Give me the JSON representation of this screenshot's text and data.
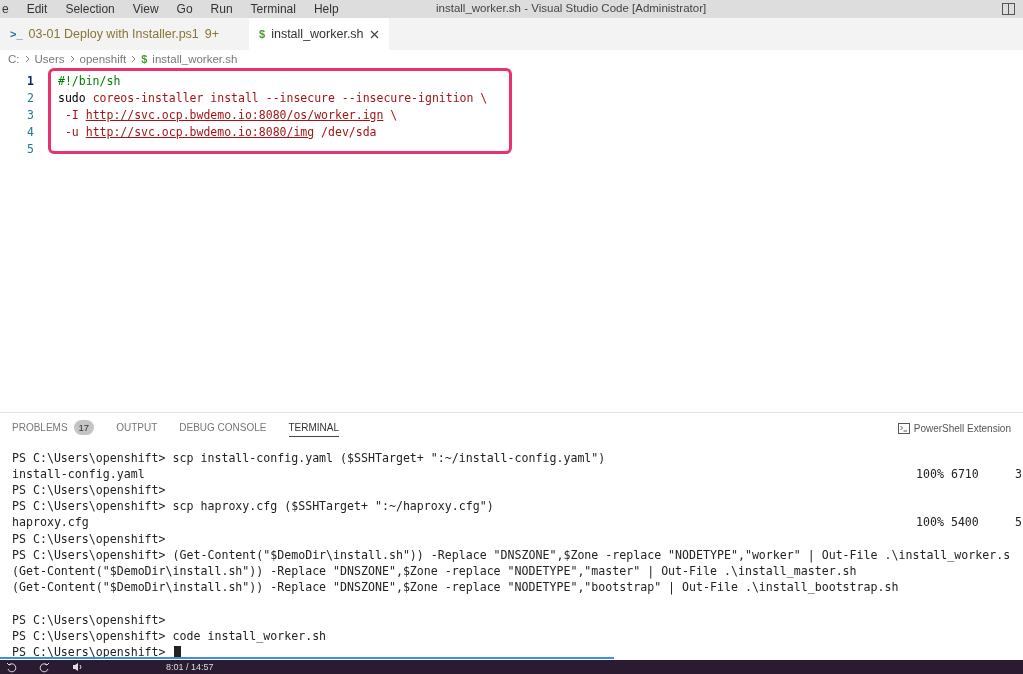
{
  "menu": [
    "e",
    "Edit",
    "Selection",
    "View",
    "Go",
    "Run",
    "Terminal",
    "Help"
  ],
  "window": {
    "title": "install_worker.sh - Visual Studio Code [Administrator]"
  },
  "tabs": [
    {
      "icon": ">_",
      "label": "03-01 Deploy with Installer.ps1",
      "badge": "9+",
      "selected": false
    },
    {
      "icon": "$",
      "label": "install_worker.sh",
      "selected": true
    }
  ],
  "breadcrumb": [
    {
      "label": "C:"
    },
    {
      "label": "Users"
    },
    {
      "label": "openshift"
    },
    {
      "icon": "$",
      "label": "install_worker.sh"
    }
  ],
  "editor": {
    "lines": [
      {
        "number": "1",
        "current": true,
        "tokens": [
          {
            "kind": "comment",
            "text": "#!/bin/sh"
          }
        ]
      },
      {
        "number": "2",
        "current": false,
        "tokens": [
          {
            "kind": "plain",
            "text": "sudo "
          },
          {
            "kind": "string",
            "text": "coreos-installer install --insecure --insecure-ignition \\"
          }
        ]
      },
      {
        "number": "3",
        "current": false,
        "tokens": [
          {
            "kind": "string",
            "text": " -I "
          },
          {
            "kind": "link",
            "text": "http://svc.ocp.bwdemo.io:8080/os/worker.ign"
          },
          {
            "kind": "string",
            "text": " \\"
          }
        ]
      },
      {
        "number": "4",
        "current": false,
        "tokens": [
          {
            "kind": "string",
            "text": " -u "
          },
          {
            "kind": "link",
            "text": "http://svc.ocp.bwdemo.io:8080/img"
          },
          {
            "kind": "string",
            "text": " /dev/sda"
          }
        ]
      },
      {
        "number": "5",
        "current": false
      }
    ]
  },
  "panel": {
    "tabs": [
      {
        "label": "PROBLEMS",
        "badge": "17",
        "selected": false
      },
      {
        "label": "OUTPUT",
        "selected": false
      },
      {
        "label": "DEBUG CONSOLE",
        "selected": false
      },
      {
        "label": "TERMINAL",
        "selected": true
      }
    ],
    "terminal_name": "PowerShell Extension",
    "lines": [
      {
        "text": "PS C:\\Users\\openshift> scp install-config.yaml ($SSHTarget+ \":~/install-config.yaml\")"
      },
      {
        "text": "install-config.yaml",
        "column_2": "100% 6710",
        "column_3": "3"
      },
      {
        "text": "PS C:\\Users\\openshift>"
      },
      {
        "text": "PS C:\\Users\\openshift> scp haproxy.cfg ($SSHTarget+ \":~/haproxy.cfg\")"
      },
      {
        "text": "haproxy.cfg",
        "column_2": "100% 5400",
        "column_3": "5"
      },
      {
        "text": "PS C:\\Users\\openshift>"
      },
      {
        "text": "PS C:\\Users\\openshift> (Get-Content(\"$DemoDir\\install.sh\")) -Replace \"DNSZONE\",$Zone -replace \"NODETYPE\",\"worker\" | Out-File .\\install_worker.s"
      },
      {
        "text": "(Get-Content(\"$DemoDir\\install.sh\")) -Replace \"DNSZONE\",$Zone -replace \"NODETYPE\",\"master\" | Out-File .\\install_master.sh"
      },
      {
        "text": "(Get-Content(\"$DemoDir\\install.sh\")) -Replace \"DNSZONE\",$Zone -replace \"NODETYPE\",\"bootstrap\" | Out-File .\\install_bootstrap.sh"
      },
      {
        "text": "PS C:\\Users\\openshift>",
        "gap_before": true
      },
      {
        "text": "PS C:\\Users\\openshift> code install_worker.sh"
      },
      {
        "text": "PS C:\\Users\\openshift>",
        "cursor": true
      }
    ]
  },
  "video": {
    "level": 0.6,
    "time": "8:01 / 14:57"
  }
}
